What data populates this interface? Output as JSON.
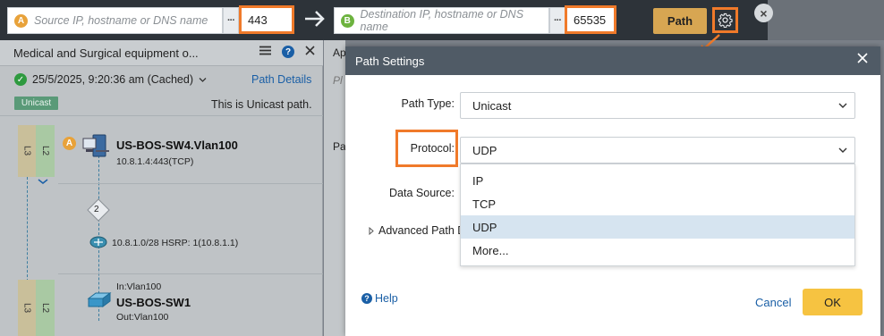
{
  "topbar": {
    "source_badge": "A",
    "source_placeholder": "Source IP, hostname or DNS name",
    "source_port": "443",
    "dest_badge": "B",
    "dest_placeholder": "Destination IP, hostname or DNS name",
    "dest_port": "65535",
    "more_label": "···",
    "path_button": "Path",
    "close_label": "×",
    "colors": {
      "highlight": "#f07a2a",
      "path_button": "#d7a652",
      "badge": "#e8a23a",
      "badge_b": "#6db33f"
    }
  },
  "left_panel": {
    "title": "Medical and Surgical equipment o...",
    "date": "25/5/2025, 9:20:36 am (Cached)",
    "path_details": "Path Details",
    "unicast_tag": "Unicast",
    "unicast_text": "This is Unicast path.",
    "layers": {
      "l3": "L3",
      "l2": "L2"
    },
    "device1": {
      "badge": "A",
      "name": "US-BOS-SW4.Vlan100",
      "sub": "10.8.1.4:443(TCP)"
    },
    "hop_count": "2",
    "subnet": "10.8.1.0/28 HSRP: 1(10.8.1.1)",
    "device2": {
      "in": "In:Vlan100",
      "name": "US-BOS-SW1",
      "out": "Out:Vlan100"
    }
  },
  "mid_strip": {
    "text1": "Ap",
    "text2": "Pl",
    "text3": "Pa"
  },
  "dialog": {
    "title": "Path Settings",
    "path_type_label": "Path Type:",
    "path_type_value": "Unicast",
    "protocol_label": "Protocol:",
    "protocol_value": "UDP",
    "data_source_label": "Data Source:",
    "advanced_label": "Advanced Path D",
    "options": [
      "IP",
      "TCP",
      "UDP",
      "More..."
    ],
    "help": "Help",
    "cancel": "Cancel",
    "ok": "OK"
  }
}
